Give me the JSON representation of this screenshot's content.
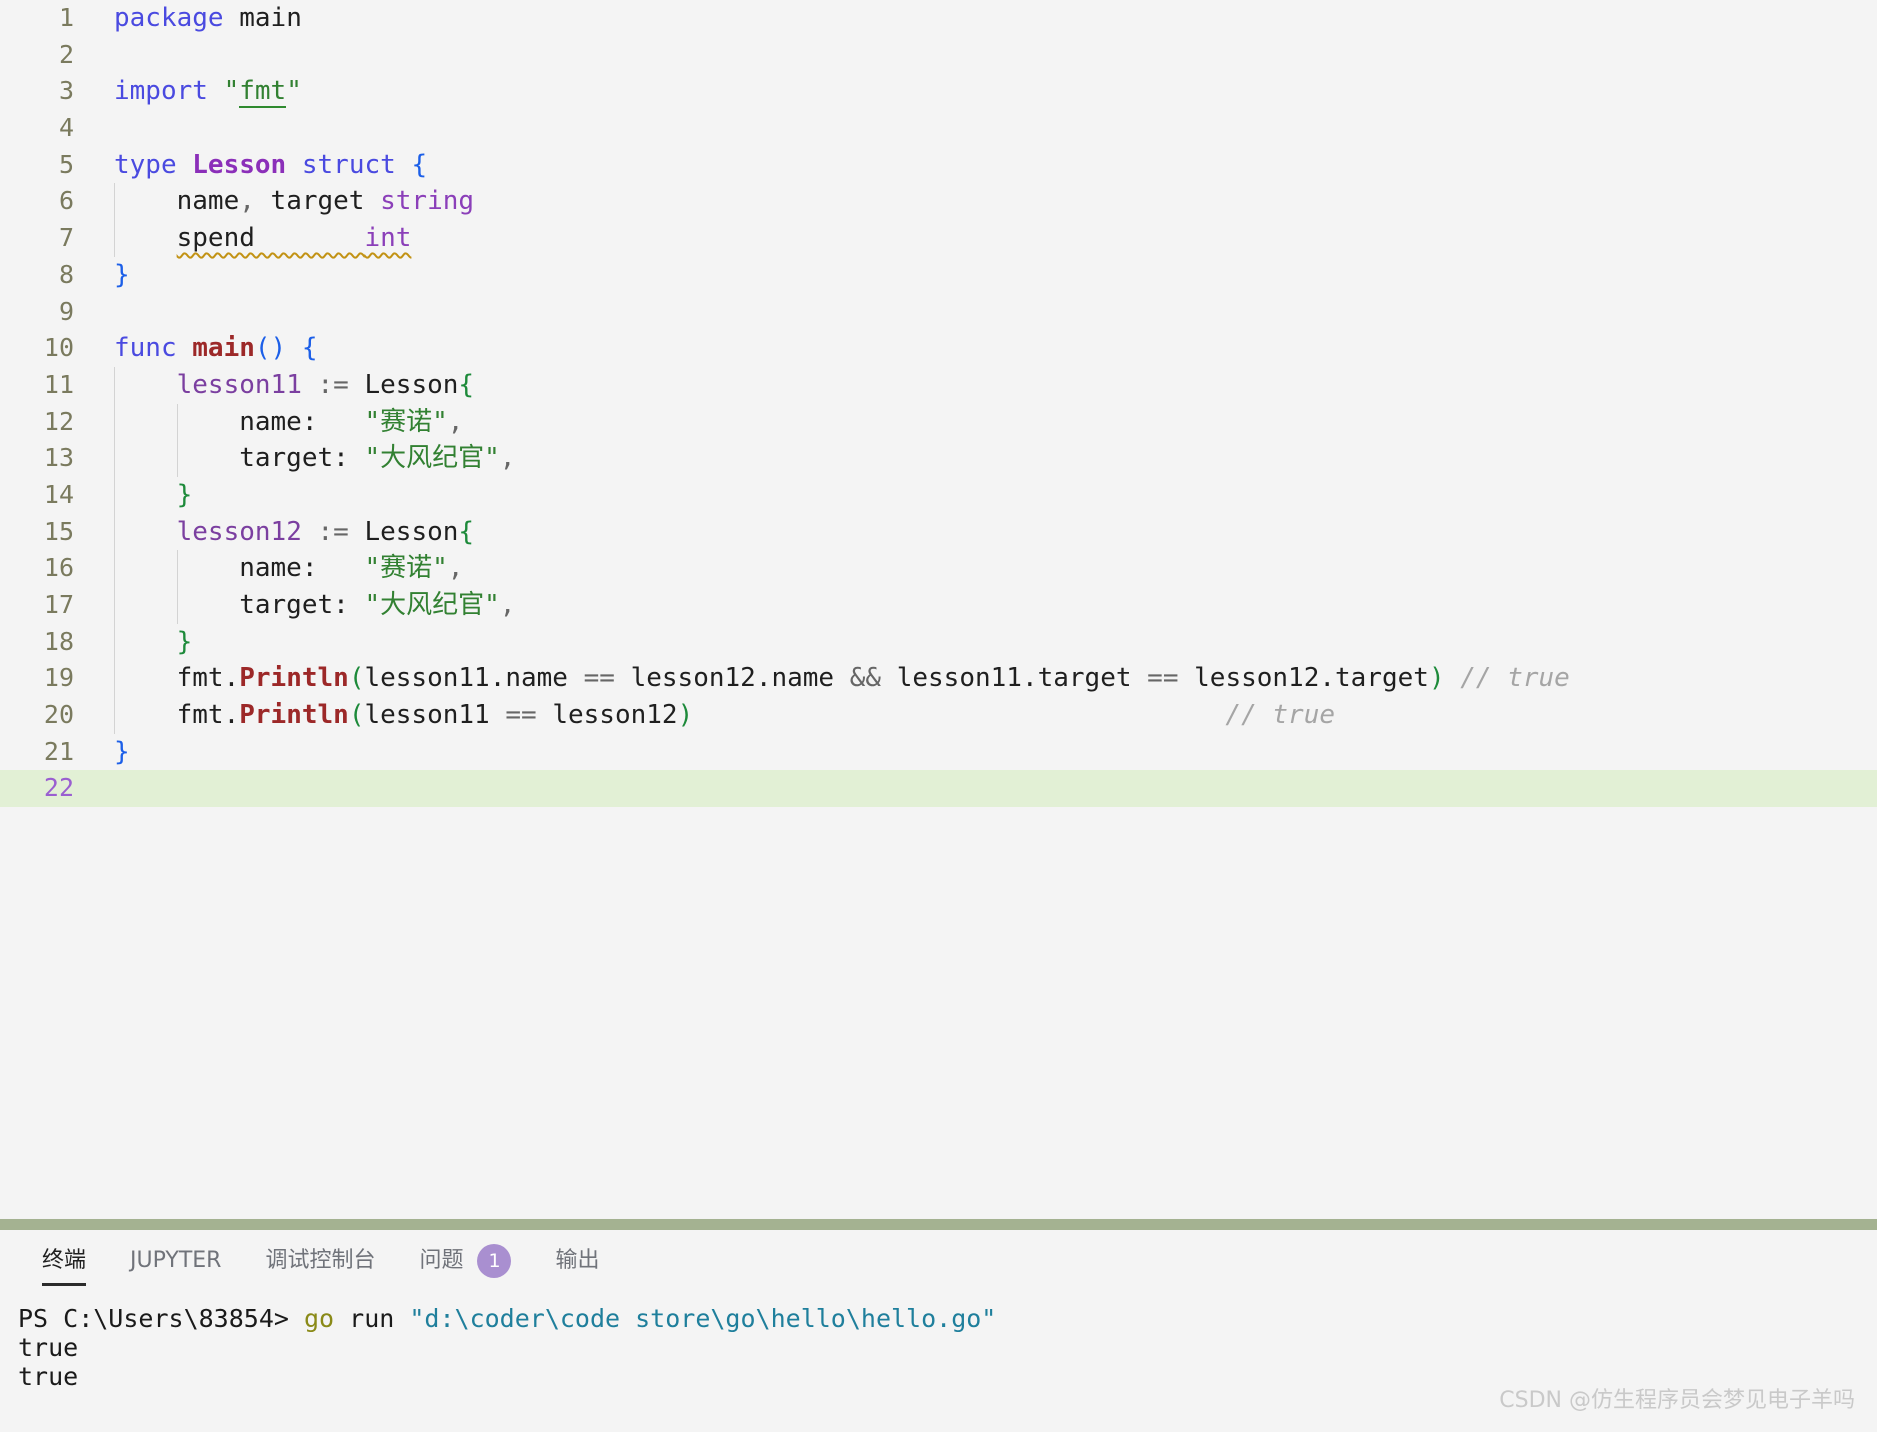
{
  "editor": {
    "language": "go",
    "active_line": 22,
    "active_line_bg": "#e2f0d5",
    "background": "#f4f4f4",
    "lines": [
      {
        "n": "1",
        "segments": [
          {
            "t": "package",
            "c": "kw"
          },
          {
            "t": " ",
            "c": "punc"
          },
          {
            "t": "main",
            "c": "ident"
          }
        ]
      },
      {
        "n": "2",
        "segments": []
      },
      {
        "n": "3",
        "segments": [
          {
            "t": "import",
            "c": "kw"
          },
          {
            "t": " ",
            "c": "punc"
          },
          {
            "t": "\"",
            "c": "strq"
          },
          {
            "t": "fmt",
            "c": "str link"
          },
          {
            "t": "\"",
            "c": "strq"
          }
        ]
      },
      {
        "n": "4",
        "segments": []
      },
      {
        "n": "5",
        "segments": [
          {
            "t": "type",
            "c": "kw"
          },
          {
            "t": " ",
            "c": "punc"
          },
          {
            "t": "Lesson",
            "c": "typ"
          },
          {
            "t": " ",
            "c": "punc"
          },
          {
            "t": "struct",
            "c": "kw"
          },
          {
            "t": " ",
            "c": "punc"
          },
          {
            "t": "{",
            "c": "br-blue"
          }
        ]
      },
      {
        "n": "6",
        "segments": [
          {
            "t": "    name",
            "c": "ident"
          },
          {
            "t": ",",
            "c": "op"
          },
          {
            "t": " target ",
            "c": "ident"
          },
          {
            "t": "string",
            "c": "builtin"
          }
        ]
      },
      {
        "n": "7",
        "segments": [
          {
            "t": "    ",
            "c": "punc"
          },
          {
            "t": "spend       ",
            "c": "ident squiggle-start"
          },
          {
            "t": "int",
            "c": "builtin squiggle-end"
          }
        ]
      },
      {
        "n": "8",
        "segments": [
          {
            "t": "}",
            "c": "br-blue"
          }
        ]
      },
      {
        "n": "9",
        "segments": []
      },
      {
        "n": "10",
        "segments": [
          {
            "t": "func",
            "c": "kw"
          },
          {
            "t": " ",
            "c": "punc"
          },
          {
            "t": "main",
            "c": "fn"
          },
          {
            "t": "()",
            "c": "br-blue"
          },
          {
            "t": " ",
            "c": "punc"
          },
          {
            "t": "{",
            "c": "br-blue"
          }
        ]
      },
      {
        "n": "11",
        "segments": [
          {
            "t": "    ",
            "c": "punc"
          },
          {
            "t": "lesson11",
            "c": "var"
          },
          {
            "t": " ",
            "c": "punc"
          },
          {
            "t": ":=",
            "c": "op"
          },
          {
            "t": " Lesson",
            "c": "ident"
          },
          {
            "t": "{",
            "c": "br-green"
          }
        ]
      },
      {
        "n": "12",
        "segments": [
          {
            "t": "        name",
            "c": "ident"
          },
          {
            "t": ":",
            "c": "punc"
          },
          {
            "t": "   ",
            "c": "punc"
          },
          {
            "t": "\"赛诺\"",
            "c": "str"
          },
          {
            "t": ",",
            "c": "op"
          }
        ]
      },
      {
        "n": "13",
        "segments": [
          {
            "t": "        target",
            "c": "ident"
          },
          {
            "t": ":",
            "c": "punc"
          },
          {
            "t": " ",
            "c": "punc"
          },
          {
            "t": "\"大风纪官\"",
            "c": "str"
          },
          {
            "t": ",",
            "c": "op"
          }
        ]
      },
      {
        "n": "14",
        "segments": [
          {
            "t": "    ",
            "c": "punc"
          },
          {
            "t": "}",
            "c": "br-green"
          }
        ]
      },
      {
        "n": "15",
        "segments": [
          {
            "t": "    ",
            "c": "punc"
          },
          {
            "t": "lesson12",
            "c": "var"
          },
          {
            "t": " ",
            "c": "punc"
          },
          {
            "t": ":=",
            "c": "op"
          },
          {
            "t": " Lesson",
            "c": "ident"
          },
          {
            "t": "{",
            "c": "br-green"
          }
        ]
      },
      {
        "n": "16",
        "segments": [
          {
            "t": "        name",
            "c": "ident"
          },
          {
            "t": ":",
            "c": "punc"
          },
          {
            "t": "   ",
            "c": "punc"
          },
          {
            "t": "\"赛诺\"",
            "c": "str"
          },
          {
            "t": ",",
            "c": "op"
          }
        ]
      },
      {
        "n": "17",
        "segments": [
          {
            "t": "        target",
            "c": "ident"
          },
          {
            "t": ":",
            "c": "punc"
          },
          {
            "t": " ",
            "c": "punc"
          },
          {
            "t": "\"大风纪官\"",
            "c": "str"
          },
          {
            "t": ",",
            "c": "op"
          }
        ]
      },
      {
        "n": "18",
        "segments": [
          {
            "t": "    ",
            "c": "punc"
          },
          {
            "t": "}",
            "c": "br-green"
          }
        ]
      },
      {
        "n": "19",
        "segments": [
          {
            "t": "    fmt",
            "c": "ident"
          },
          {
            "t": ".",
            "c": "punc"
          },
          {
            "t": "Println",
            "c": "fn"
          },
          {
            "t": "(",
            "c": "br-green"
          },
          {
            "t": "lesson11.name ",
            "c": "ident"
          },
          {
            "t": "==",
            "c": "op"
          },
          {
            "t": " lesson12.name ",
            "c": "ident"
          },
          {
            "t": "&&",
            "c": "op"
          },
          {
            "t": " lesson11.target ",
            "c": "ident"
          },
          {
            "t": "==",
            "c": "op"
          },
          {
            "t": " lesson12.target",
            "c": "ident"
          },
          {
            "t": ")",
            "c": "br-green"
          },
          {
            "t": " // true",
            "c": "cmt"
          }
        ]
      },
      {
        "n": "20",
        "segments": [
          {
            "t": "    fmt",
            "c": "ident"
          },
          {
            "t": ".",
            "c": "punc"
          },
          {
            "t": "Println",
            "c": "fn"
          },
          {
            "t": "(",
            "c": "br-green"
          },
          {
            "t": "lesson11 ",
            "c": "ident"
          },
          {
            "t": "==",
            "c": "op"
          },
          {
            "t": " lesson12",
            "c": "ident"
          },
          {
            "t": ")",
            "c": "br-green"
          },
          {
            "t": "                                  // true",
            "c": "cmt"
          }
        ]
      },
      {
        "n": "21",
        "segments": [
          {
            "t": "}",
            "c": "br-blue"
          }
        ]
      },
      {
        "n": "22",
        "segments": [],
        "active": true
      }
    ]
  },
  "panel": {
    "tabs": [
      {
        "label": "终端",
        "active": true,
        "badge": null
      },
      {
        "label": "JUPYTER",
        "active": false,
        "badge": null
      },
      {
        "label": "调试控制台",
        "active": false,
        "badge": null
      },
      {
        "label": "问题",
        "active": false,
        "badge": "1"
      },
      {
        "label": "输出",
        "active": false,
        "badge": null
      }
    ],
    "badge_color": "#a98fd0",
    "divider_color": "#a4b291",
    "terminal": {
      "lines": [
        {
          "parts": [
            {
              "t": "PS C:\\Users\\83854> ",
              "c": "t-prompt"
            },
            {
              "t": "go ",
              "c": "t-cmd"
            },
            {
              "t": "run ",
              "c": "t-arg"
            },
            {
              "t": "\"d:\\coder\\code store\\go\\hello\\hello.go\"",
              "c": "t-path"
            }
          ]
        },
        {
          "parts": [
            {
              "t": "true",
              "c": "t-out"
            }
          ]
        },
        {
          "parts": [
            {
              "t": "true",
              "c": "t-out"
            }
          ]
        }
      ]
    }
  },
  "watermark": {
    "text": "CSDN @仿生程序员会梦见电子羊吗"
  }
}
